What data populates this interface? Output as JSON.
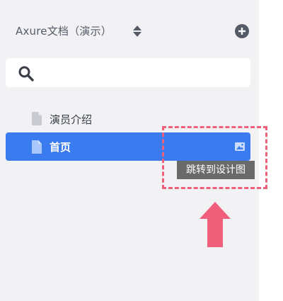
{
  "header": {
    "project_title": "Axure文档（演示）",
    "sort_icon": "up-down-caret-icon",
    "add_icon": "plus-circle-icon"
  },
  "search": {
    "icon": "search-icon",
    "value": "",
    "placeholder": ""
  },
  "pages": [
    {
      "label": "演员介绍",
      "icon": "page-icon",
      "selected": false
    },
    {
      "label": "首页",
      "icon": "page-icon",
      "selected": true,
      "action_icon": "image-icon"
    }
  ],
  "annotation": {
    "tooltip": "跳转到设计图",
    "highlight_color": "#f0607a",
    "arrow_color": "#f0607a"
  },
  "colors": {
    "sidebar_bg": "#f2f2f5",
    "selected_bg": "#3a7bf0",
    "tooltip_bg": "#6a6a6a"
  }
}
